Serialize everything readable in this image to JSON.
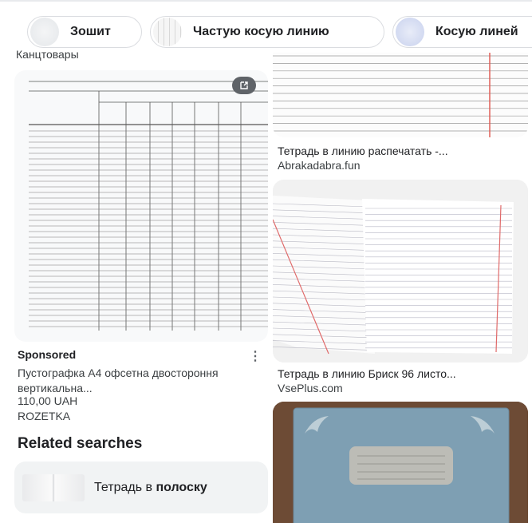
{
  "chips": [
    {
      "label": "Зошит"
    },
    {
      "label": "Частую косую линию"
    },
    {
      "label": "Косую линей"
    }
  ],
  "left": {
    "caption": "Канцтовары",
    "ad": {
      "sponsored": "Sponsored",
      "more": "⋮",
      "title": "Пустографка А4 офсетна двостороння вертикальна...",
      "price": "110,00 UAH",
      "store": "ROZETKA",
      "open_icon": "open-in-new-icon"
    },
    "related": {
      "heading": "Related searches",
      "item_prefix": "Тетрадь в ",
      "item_bold": "полоску"
    }
  },
  "right": {
    "item1": {
      "caption": "Тетрадь в линию распечатать -...",
      "source": "Abrakadabra.fun"
    },
    "item2": {
      "caption": "Тетрадь в линию Бриск 96 листо...",
      "source": "VsePlus.com"
    }
  }
}
